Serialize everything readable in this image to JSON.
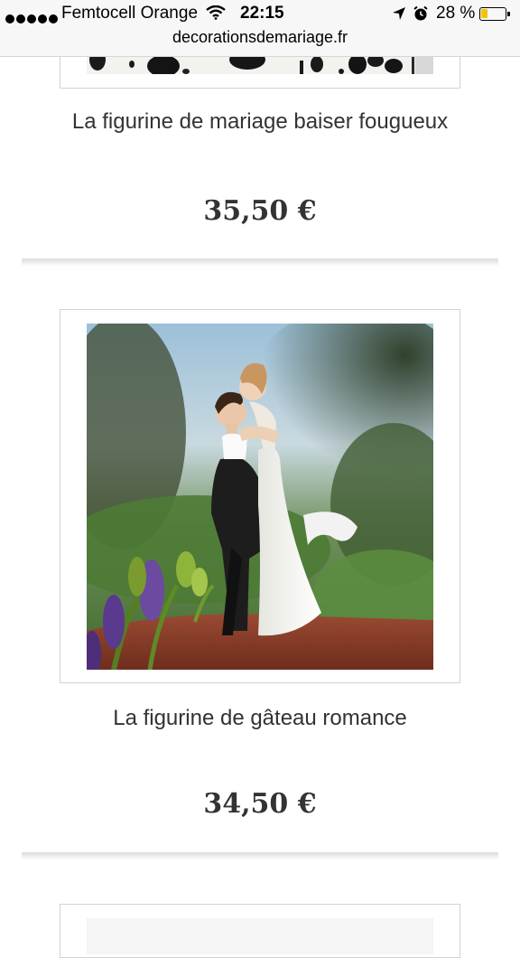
{
  "status_bar": {
    "carrier": "Femtocell Orange",
    "time": "22:15",
    "battery_percent": "28 %",
    "battery_level": 0.28,
    "icons": [
      "signal-dots-icon",
      "wifi-icon",
      "location-arrow-icon",
      "alarm-icon",
      "battery-icon"
    ]
  },
  "browser": {
    "url": "decorationsdemariage.fr"
  },
  "products": [
    {
      "title": "La figurine de mariage baiser fougueux",
      "price": "35,50 €"
    },
    {
      "title": "La figurine de gâteau romance",
      "price": "34,50 €"
    }
  ],
  "colors": {
    "price_text": "#333333",
    "accent_battery": "#f5c400"
  }
}
